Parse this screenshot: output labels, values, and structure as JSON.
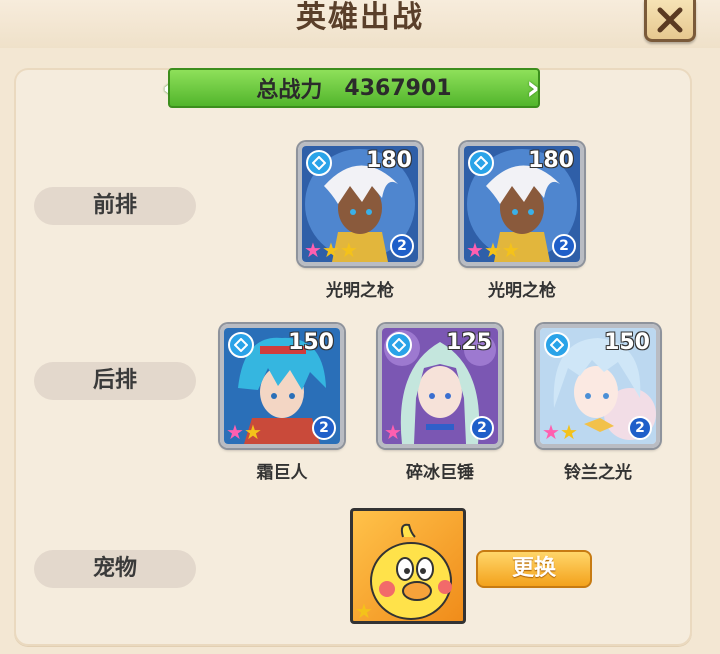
{
  "header": {
    "title": "英雄出战"
  },
  "power": {
    "label": "总战力",
    "value": "4367901"
  },
  "rows": {
    "front": "前排",
    "back": "后排",
    "pet": "宠物"
  },
  "front_row": [
    {
      "name": "光明之枪",
      "level": "180",
      "tier": "2",
      "stars": 3
    },
    {
      "name": "光明之枪",
      "level": "180",
      "tier": "2",
      "stars": 3
    }
  ],
  "back_row": [
    {
      "name": "霜巨人",
      "level": "150",
      "tier": "2",
      "stars": 2
    },
    {
      "name": "碎冰巨锤",
      "level": "125",
      "tier": "2",
      "stars": 1
    },
    {
      "name": "铃兰之光",
      "level": "150",
      "tier": "2",
      "stars": 2
    }
  ],
  "pet": {
    "stars": 1,
    "swap_label": "更换"
  },
  "colors": {
    "accent_green": "#52b52c",
    "tier_blue": "#1f5fc9",
    "element_blue": "#2aa3e8",
    "button_orange": "#f3a21c"
  }
}
